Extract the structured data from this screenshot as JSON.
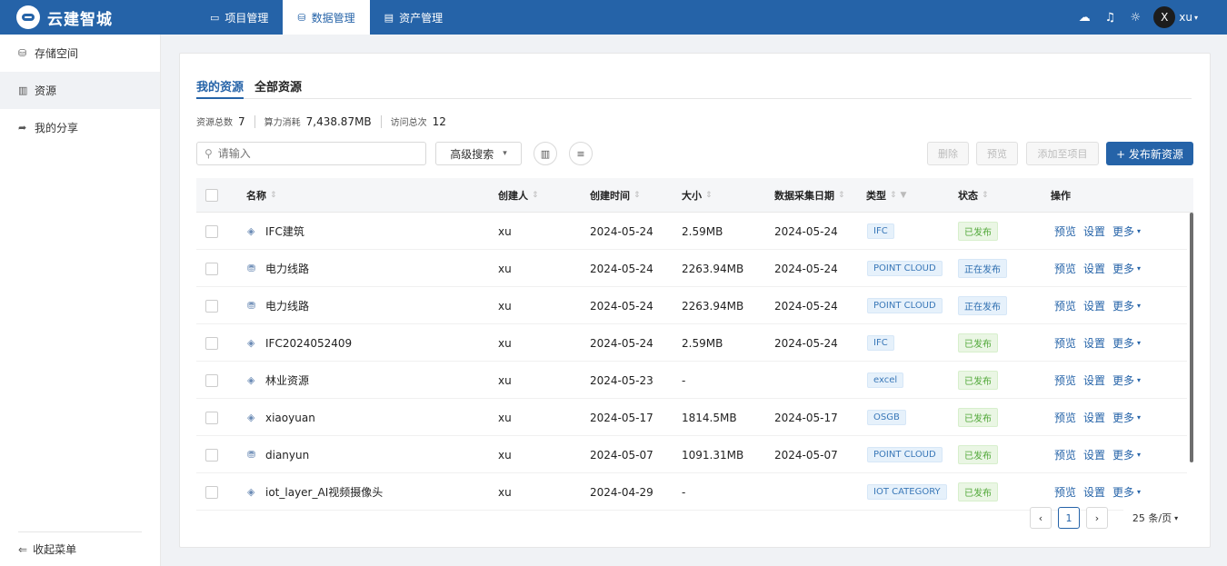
{
  "app": {
    "title": "云建智城",
    "colors": {
      "brand": "#2563a8",
      "published": "#52a83a"
    }
  },
  "nav": {
    "tabs": [
      {
        "label": "项目管理",
        "icon": "monitor-icon"
      },
      {
        "label": "数据管理",
        "icon": "database-icon"
      },
      {
        "label": "资产管理",
        "icon": "document-icon"
      }
    ]
  },
  "user": {
    "avatar": "X",
    "name": "xu"
  },
  "sidebar": {
    "items": [
      {
        "label": "存储空间",
        "icon": "storage-icon"
      },
      {
        "label": "资源",
        "icon": "book-icon"
      },
      {
        "label": "我的分享",
        "icon": "share-icon"
      }
    ],
    "collapse": "收起菜单"
  },
  "main": {
    "tabs": [
      "我的资源",
      "全部资源"
    ],
    "stats": [
      {
        "label": "资源总数",
        "value": "7"
      },
      {
        "label": "算力消耗",
        "value": "7,438.87MB"
      },
      {
        "label": "访问总次",
        "value": "12"
      }
    ],
    "search_placeholder": "请输入",
    "advanced_search": "高级搜索",
    "buttons": {
      "delete": "删除",
      "preview": "预览",
      "add_to_project": "添加至项目",
      "publish": "+ 发布新资源"
    }
  },
  "table": {
    "headers": {
      "name": "名称",
      "creator": "创建人",
      "created": "创建时间",
      "size": "大小",
      "collect_date": "数据采集日期",
      "type": "类型",
      "status": "状态",
      "actions": "操作"
    },
    "rows": [
      {
        "name": "IFC建筑",
        "icon": "layers",
        "creator": "xu",
        "created": "2024-05-24",
        "size": "2.59MB",
        "collect": "2024-05-24",
        "type": "IFC",
        "status": "已发布",
        "published": true
      },
      {
        "name": "电力线路",
        "icon": "cloud",
        "creator": "xu",
        "created": "2024-05-24",
        "size": "2263.94MB",
        "collect": "2024-05-24",
        "type": "POINT CLOUD",
        "status": "正在发布",
        "published": false
      },
      {
        "name": "电力线路",
        "icon": "cloud",
        "creator": "xu",
        "created": "2024-05-24",
        "size": "2263.94MB",
        "collect": "2024-05-24",
        "type": "POINT CLOUD",
        "status": "正在发布",
        "published": false
      },
      {
        "name": "IFC2024052409",
        "icon": "layers",
        "creator": "xu",
        "created": "2024-05-24",
        "size": "2.59MB",
        "collect": "2024-05-24",
        "type": "IFC",
        "status": "已发布",
        "published": true
      },
      {
        "name": "林业资源",
        "icon": "layers",
        "creator": "xu",
        "created": "2024-05-23",
        "size": "-",
        "collect": "",
        "type": "excel",
        "status": "已发布",
        "published": true
      },
      {
        "name": "xiaoyuan",
        "icon": "layers",
        "creator": "xu",
        "created": "2024-05-17",
        "size": "1814.5MB",
        "collect": "2024-05-17",
        "type": "OSGB",
        "status": "已发布",
        "published": true
      },
      {
        "name": "dianyun",
        "icon": "cloud",
        "creator": "xu",
        "created": "2024-05-07",
        "size": "1091.31MB",
        "collect": "2024-05-07",
        "type": "POINT CLOUD",
        "status": "已发布",
        "published": true
      },
      {
        "name": "iot_layer_AI视频摄像头",
        "icon": "layers",
        "creator": "xu",
        "created": "2024-04-29",
        "size": "-",
        "collect": "",
        "type": "IOT CATEGORY",
        "status": "已发布",
        "published": true
      }
    ],
    "row_actions": {
      "preview": "预览",
      "settings": "设置",
      "more": "更多"
    }
  },
  "pagination": {
    "current": "1",
    "page_size": "25 条/页"
  }
}
